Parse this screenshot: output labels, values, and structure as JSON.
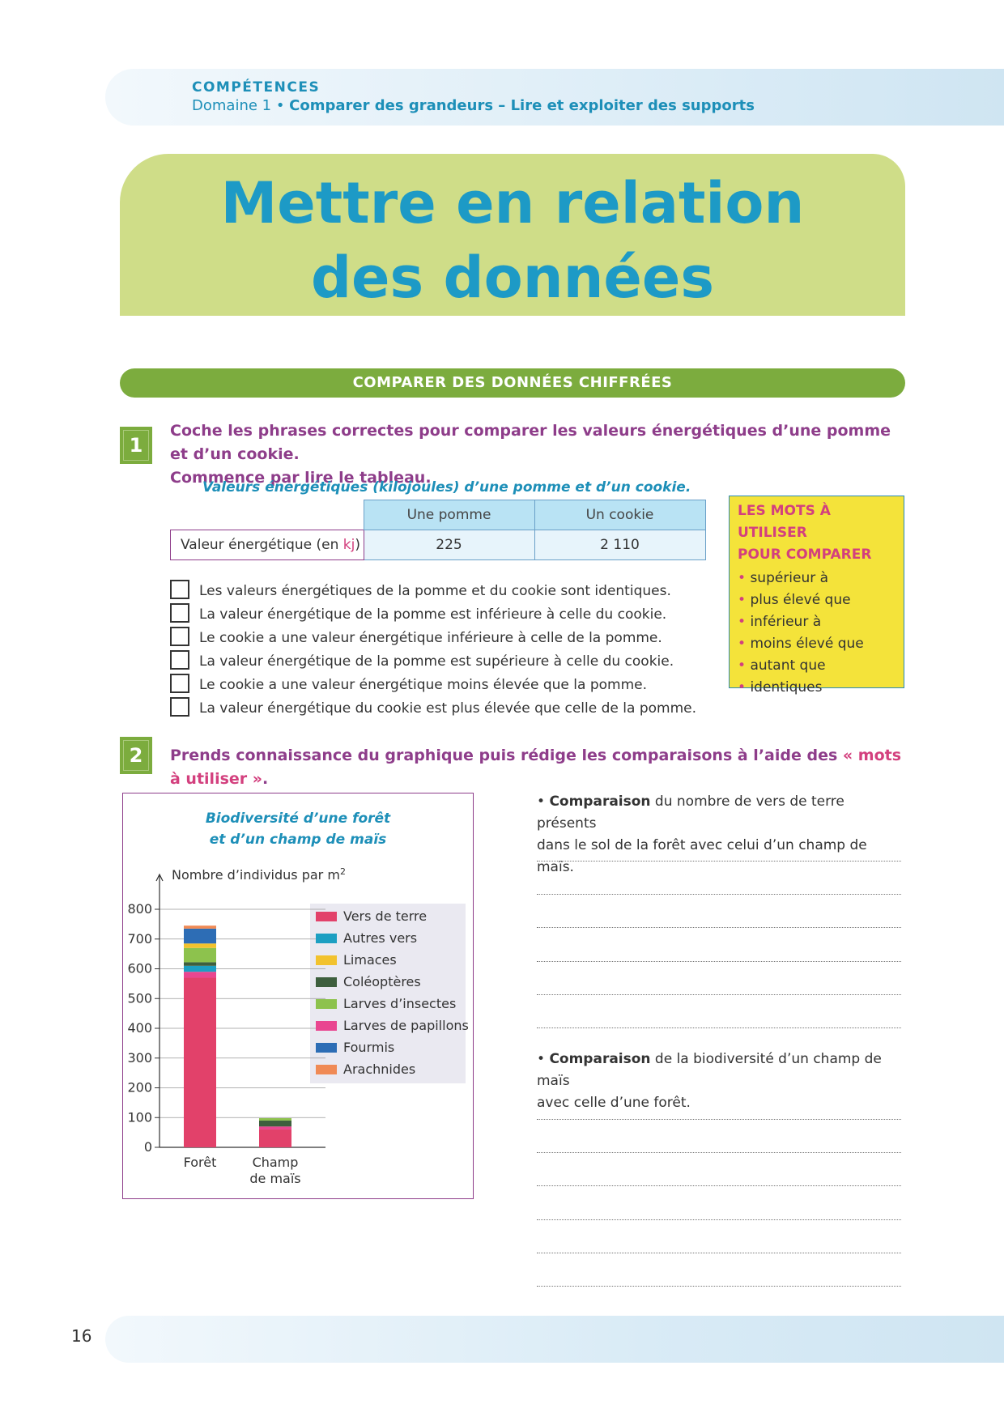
{
  "header": {
    "competences": "COMPÉTENCES",
    "domain": "Domaine 1 • ",
    "domain_bold": "Comparer des grandeurs – Lire et exploiter des supports"
  },
  "title": {
    "line1": "Mettre en relation",
    "line2": "des données"
  },
  "section_bar": "COMPARER DES DONNÉES CHIFFRÉES",
  "q1": {
    "number": "1",
    "text_line1": "Coche les phrases correctes pour comparer les valeurs énergétiques d’une pomme et d’un cookie.",
    "text_line2": "Commence par lire le tableau.",
    "table_title": "Valeurs énergétiques (kilojoules) d’une pomme et d’un cookie.",
    "table": {
      "col1": "Une pomme",
      "col2": "Un cookie",
      "row_label": "Valeur énergétique (en ",
      "row_unit": "kj",
      "row_close": ")",
      "v1": "225",
      "v2": "2 110"
    },
    "options": [
      "Les valeurs énergétiques de la pomme et du cookie sont identiques.",
      "La valeur énergétique de la pomme est inférieure à celle du cookie.",
      "Le cookie a une valeur énergétique inférieure à celle de la pomme.",
      "La valeur énergétique de la pomme est supérieure à celle du cookie.",
      "Le cookie a une valeur énergétique moins élevée que la pomme.",
      "La valeur énergétique du cookie est plus élevée que celle de la pomme."
    ]
  },
  "words_box": {
    "title1": "LES MOTS À UTILISER",
    "title2": "POUR COMPARER",
    "items": [
      "supérieur à",
      "plus élevé que",
      "inférieur à",
      "moins élevé que",
      "autant que",
      "identiques"
    ]
  },
  "q2": {
    "number": "2",
    "text": "Prends connaissance du graphique puis rédige les comparaisons à l’aide des ",
    "text_highlight": "« mots à utiliser »",
    "text_end": ".",
    "comp1_bold": "Comparaison",
    "comp1_line1": " du nombre de vers de terre présents",
    "comp1_line2": "dans le sol de la forêt avec celui d’un champ de maïs.",
    "comp2_bold": "Comparaison",
    "comp2_line1": " de la biodiversité d’un champ de maïs",
    "comp2_line2": "avec celle d’une forêt."
  },
  "chart_data": {
    "type": "bar",
    "stacked": true,
    "title_line1": "Biodiversité d’une forêt",
    "title_line2": "et d’un champ de maïs",
    "ylabel": "Nombre d’individus par m",
    "ylabel_sup": "2",
    "ylim": [
      0,
      800
    ],
    "yticks": [
      "0",
      "100",
      "200",
      "300",
      "400",
      "500",
      "600",
      "700",
      "800"
    ],
    "ytick_values": [
      0,
      100,
      200,
      300,
      400,
      500,
      600,
      700,
      800
    ],
    "categories": [
      "Forêt",
      "Champ de maïs"
    ],
    "category_lines": [
      [
        "Forêt"
      ],
      [
        "Champ",
        "de maïs"
      ]
    ],
    "series": [
      {
        "name": "Vers de terre",
        "color": "#e2416a",
        "values": [
          570,
          60
        ]
      },
      {
        "name": "Larves de papillons",
        "color": "#e94690",
        "values": [
          20,
          10
        ]
      },
      {
        "name": "Autres vers",
        "color": "#1c9fc2",
        "values": [
          20,
          0
        ]
      },
      {
        "name": "Coléoptères",
        "color": "#3e5f3e",
        "values": [
          12,
          20
        ]
      },
      {
        "name": "Larves d’insectes",
        "color": "#8dc24d",
        "values": [
          48,
          8
        ]
      },
      {
        "name": "Limaces",
        "color": "#f2c22e",
        "values": [
          15,
          0
        ]
      },
      {
        "name": "Fourmis",
        "color": "#2d6db5",
        "values": [
          50,
          0
        ]
      },
      {
        "name": "Arachnides",
        "color": "#f08a55",
        "values": [
          10,
          0
        ]
      }
    ],
    "legend": [
      {
        "name": "Vers de terre",
        "color": "#e2416a"
      },
      {
        "name": "Autres vers",
        "color": "#1c9fc2"
      },
      {
        "name": "Limaces",
        "color": "#f2c22e"
      },
      {
        "name": "Coléoptères",
        "color": "#3e5f3e"
      },
      {
        "name": "Larves d’insectes",
        "color": "#8dc24d"
      },
      {
        "name": "Larves de papillons",
        "color": "#e94690"
      },
      {
        "name": "Fourmis",
        "color": "#2d6db5"
      },
      {
        "name": "Arachnides",
        "color": "#f08a55"
      }
    ]
  },
  "page_number": "16"
}
